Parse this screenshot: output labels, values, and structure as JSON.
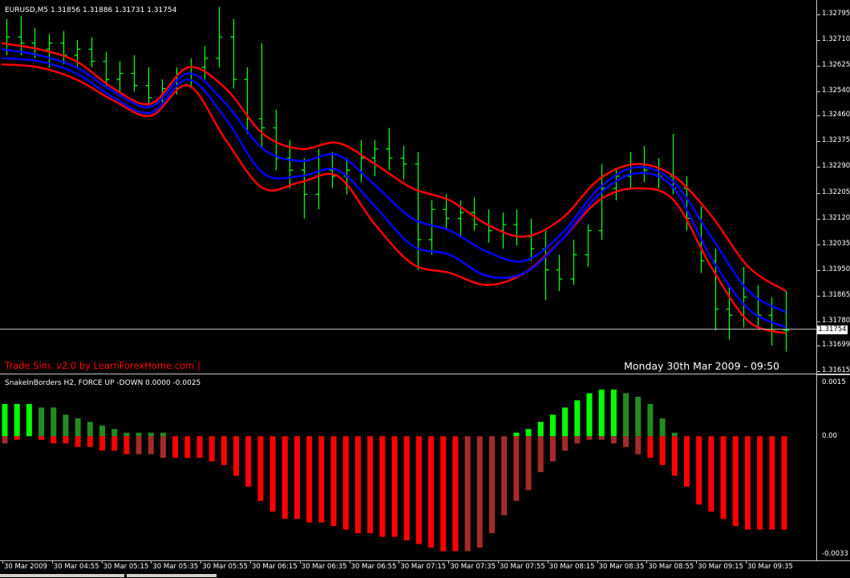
{
  "chart": {
    "symbol_info": "EURUSD,M5  1.31856 1.31886 1.31731 1.31754",
    "trade_sim": "Trade Sim. v2.0 by LearnForexHome.com |",
    "datetime": "Monday 30th Mar 2009 - 09:50",
    "current_price": "1.31754",
    "price_scale": [
      "1.32795",
      "1.32710",
      "1.32625",
      "1.32540",
      "1.32460",
      "1.32375",
      "1.32290",
      "1.32205",
      "1.32120",
      "1.32035",
      "1.31950",
      "1.31865",
      "1.31780",
      "1.31699",
      "1.31615"
    ],
    "indicator_title": "SnakeInBorders H2, FORCE UP -DOWN  0.0000 -0.0025",
    "indicator_scale": [
      "0.0015",
      "0.00",
      "-0.0033"
    ],
    "time_labels": [
      "30 Mar 2009",
      "30 Mar 04:55",
      "30 Mar 05:15",
      "30 Mar 05:35",
      "30 Mar 05:55",
      "30 Mar 06:15",
      "30 Mar 06:35",
      "30 Mar 06:55",
      "30 Mar 07:15",
      "30 Mar 07:35",
      "30 Mar 07:55",
      "30 Mar 08:15",
      "30 Mar 08:35",
      "30 Mar 08:55",
      "30 Mar 09:15",
      "30 Mar 09:35"
    ],
    "colors": {
      "bars": "#00ff00",
      "upper_band": "#ff0000",
      "middle_band": "#0000ff",
      "hist_up_strong": "#00ff00",
      "hist_up_weak": "#228b22",
      "hist_down_strong": "#ff0000",
      "hist_down_weak": "#a52a2a",
      "background": "#000000"
    }
  },
  "chart_data": [
    {
      "type": "ohlc",
      "symbol": "EURUSD",
      "timeframe": "M5",
      "ylim": [
        1.31615,
        1.32795
      ],
      "bars": [
        {
          "o": 1.327,
          "h": 1.3278,
          "l": 1.3266,
          "c": 1.3272
        },
        {
          "o": 1.3272,
          "h": 1.3279,
          "l": 1.3266,
          "c": 1.327
        },
        {
          "o": 1.327,
          "h": 1.3275,
          "l": 1.3265,
          "c": 1.3268
        },
        {
          "o": 1.3268,
          "h": 1.3273,
          "l": 1.3262,
          "c": 1.327
        },
        {
          "o": 1.327,
          "h": 1.3274,
          "l": 1.3263,
          "c": 1.3266
        },
        {
          "o": 1.3266,
          "h": 1.3271,
          "l": 1.3262,
          "c": 1.3268
        },
        {
          "o": 1.3268,
          "h": 1.3272,
          "l": 1.3262,
          "c": 1.3264
        },
        {
          "o": 1.3264,
          "h": 1.3267,
          "l": 1.3255,
          "c": 1.3258
        },
        {
          "o": 1.3258,
          "h": 1.3264,
          "l": 1.3254,
          "c": 1.326
        },
        {
          "o": 1.326,
          "h": 1.3266,
          "l": 1.3254,
          "c": 1.3256
        },
        {
          "o": 1.3256,
          "h": 1.3262,
          "l": 1.325,
          "c": 1.3252
        },
        {
          "o": 1.3252,
          "h": 1.3258,
          "l": 1.325,
          "c": 1.3255
        },
        {
          "o": 1.3255,
          "h": 1.3262,
          "l": 1.3253,
          "c": 1.326
        },
        {
          "o": 1.326,
          "h": 1.3265,
          "l": 1.3255,
          "c": 1.3262
        },
        {
          "o": 1.3262,
          "h": 1.3269,
          "l": 1.3258,
          "c": 1.3265
        },
        {
          "o": 1.3265,
          "h": 1.3282,
          "l": 1.3262,
          "c": 1.3272
        },
        {
          "o": 1.3272,
          "h": 1.3278,
          "l": 1.3255,
          "c": 1.3258
        },
        {
          "o": 1.3258,
          "h": 1.3262,
          "l": 1.324,
          "c": 1.3245
        },
        {
          "o": 1.3245,
          "h": 1.327,
          "l": 1.3235,
          "c": 1.3242
        },
        {
          "o": 1.3242,
          "h": 1.3248,
          "l": 1.3228,
          "c": 1.3232
        },
        {
          "o": 1.3232,
          "h": 1.3238,
          "l": 1.3222,
          "c": 1.3228
        },
        {
          "o": 1.3228,
          "h": 1.3232,
          "l": 1.3212,
          "c": 1.322
        },
        {
          "o": 1.322,
          "h": 1.3235,
          "l": 1.3215,
          "c": 1.3228
        },
        {
          "o": 1.3228,
          "h": 1.3234,
          "l": 1.3222,
          "c": 1.3226
        },
        {
          "o": 1.3226,
          "h": 1.3232,
          "l": 1.322,
          "c": 1.3228
        },
        {
          "o": 1.3228,
          "h": 1.3238,
          "l": 1.3224,
          "c": 1.3232
        },
        {
          "o": 1.3232,
          "h": 1.3238,
          "l": 1.3226,
          "c": 1.3235
        },
        {
          "o": 1.3235,
          "h": 1.3242,
          "l": 1.3228,
          "c": 1.3232
        },
        {
          "o": 1.3232,
          "h": 1.3236,
          "l": 1.3225,
          "c": 1.323
        },
        {
          "o": 1.323,
          "h": 1.3234,
          "l": 1.3195,
          "c": 1.3205
        },
        {
          "o": 1.3205,
          "h": 1.3218,
          "l": 1.32,
          "c": 1.3215
        },
        {
          "o": 1.3215,
          "h": 1.322,
          "l": 1.3208,
          "c": 1.3212
        },
        {
          "o": 1.3212,
          "h": 1.3218,
          "l": 1.3206,
          "c": 1.3214
        },
        {
          "o": 1.3214,
          "h": 1.3219,
          "l": 1.3208,
          "c": 1.321
        },
        {
          "o": 1.321,
          "h": 1.3215,
          "l": 1.3204,
          "c": 1.3208
        },
        {
          "o": 1.3208,
          "h": 1.3214,
          "l": 1.3202,
          "c": 1.321
        },
        {
          "o": 1.321,
          "h": 1.3215,
          "l": 1.3203,
          "c": 1.3206
        },
        {
          "o": 1.3206,
          "h": 1.3212,
          "l": 1.3198,
          "c": 1.3202
        },
        {
          "o": 1.3202,
          "h": 1.3208,
          "l": 1.3185,
          "c": 1.3195
        },
        {
          "o": 1.3195,
          "h": 1.32,
          "l": 1.3188,
          "c": 1.3192
        },
        {
          "o": 1.3192,
          "h": 1.3205,
          "l": 1.319,
          "c": 1.32
        },
        {
          "o": 1.32,
          "h": 1.321,
          "l": 1.3196,
          "c": 1.3208
        },
        {
          "o": 1.3208,
          "h": 1.323,
          "l": 1.3205,
          "c": 1.3222
        },
        {
          "o": 1.3222,
          "h": 1.3228,
          "l": 1.3218,
          "c": 1.3226
        },
        {
          "o": 1.3226,
          "h": 1.3234,
          "l": 1.3222,
          "c": 1.323
        },
        {
          "o": 1.323,
          "h": 1.3236,
          "l": 1.3224,
          "c": 1.3228
        },
        {
          "o": 1.3228,
          "h": 1.3232,
          "l": 1.3222,
          "c": 1.3226
        },
        {
          "o": 1.3226,
          "h": 1.324,
          "l": 1.322,
          "c": 1.3222
        },
        {
          "o": 1.3222,
          "h": 1.3226,
          "l": 1.3208,
          "c": 1.3212
        },
        {
          "o": 1.3212,
          "h": 1.3216,
          "l": 1.3194,
          "c": 1.3198
        },
        {
          "o": 1.3198,
          "h": 1.3202,
          "l": 1.3175,
          "c": 1.3182
        },
        {
          "o": 1.3182,
          "h": 1.319,
          "l": 1.3172,
          "c": 1.318
        },
        {
          "o": 1.318,
          "h": 1.3196,
          "l": 1.3176,
          "c": 1.3186
        },
        {
          "o": 1.3186,
          "h": 1.319,
          "l": 1.3176,
          "c": 1.318
        },
        {
          "o": 1.318,
          "h": 1.3186,
          "l": 1.317,
          "c": 1.3175
        },
        {
          "o": 1.3175,
          "h": 1.3188,
          "l": 1.3168,
          "c": 1.3175
        }
      ],
      "bands": {
        "upper": [
          1.327,
          1.3268,
          1.3264,
          1.3255,
          1.325,
          1.3262,
          1.3255,
          1.324,
          1.3235,
          1.3237,
          1.323,
          1.3222,
          1.3218,
          1.321,
          1.3206,
          1.3212,
          1.3225,
          1.323,
          1.3226,
          1.3213,
          1.3196,
          1.3188
        ],
        "middle_upper": [
          1.3268,
          1.3266,
          1.3262,
          1.3254,
          1.3249,
          1.326,
          1.325,
          1.3235,
          1.3231,
          1.3233,
          1.3223,
          1.3212,
          1.3208,
          1.3201,
          1.3198,
          1.3207,
          1.3222,
          1.3229,
          1.3224,
          1.3206,
          1.3188,
          1.3181
        ],
        "middle_lower": [
          1.3265,
          1.3264,
          1.326,
          1.3252,
          1.3247,
          1.3258,
          1.3245,
          1.3227,
          1.3226,
          1.3228,
          1.3216,
          1.3203,
          1.32,
          1.3193,
          1.3194,
          1.3205,
          1.322,
          1.3227,
          1.3222,
          1.3199,
          1.3182,
          1.3176
        ],
        "lower": [
          1.3263,
          1.3262,
          1.3258,
          1.3251,
          1.3246,
          1.3256,
          1.3238,
          1.3222,
          1.3224,
          1.3226,
          1.321,
          1.3197,
          1.3194,
          1.319,
          1.3194,
          1.3205,
          1.3218,
          1.3222,
          1.3218,
          1.3196,
          1.3178,
          1.3174
        ]
      }
    },
    {
      "type": "bar",
      "title": "SnakeInBorders H2, FORCE UP -DOWN  0.0000 -0.0025",
      "ylim": [
        -0.0033,
        0.0015
      ],
      "up": [
        0.0009,
        0.0009,
        0.0009,
        0.0008,
        0.0008,
        0.0006,
        0.0005,
        0.0004,
        0.0003,
        0.0002,
        0.0001,
        0.0001,
        0.0001,
        0.0001,
        0.0,
        0.0,
        0.0,
        0.0,
        0.0,
        0.0,
        0.0,
        0.0,
        0.0,
        0.0,
        0.0,
        0.0,
        0.0,
        0.0,
        0.0,
        0.0,
        0.0,
        0.0,
        0.0,
        0.0,
        0.0,
        0.0,
        0.0,
        0.0,
        0.0,
        0.0,
        0.0,
        0.0,
        0.0001,
        0.0002,
        0.0004,
        0.0006,
        0.0008,
        0.001,
        0.0012,
        0.0013,
        0.0013,
        0.0012,
        0.0011,
        0.0009,
        0.0005,
        0.0001,
        0.0,
        0.0,
        0.0,
        0.0,
        0.0,
        0.0,
        0.0,
        0.0,
        0.0
      ],
      "down": [
        -0.0002,
        -0.0001,
        0.0,
        -0.0001,
        -0.0002,
        -0.0002,
        -0.0003,
        -0.0003,
        -0.0004,
        -0.0004,
        -0.0005,
        -0.0005,
        -0.0005,
        -0.0006,
        -0.0006,
        -0.0006,
        -0.0006,
        -0.0007,
        -0.0008,
        -0.0011,
        -0.0014,
        -0.0018,
        -0.0021,
        -0.0023,
        -0.0023,
        -0.0024,
        -0.0024,
        -0.0025,
        -0.0026,
        -0.0027,
        -0.0027,
        -0.0028,
        -0.0028,
        -0.0029,
        -0.003,
        -0.0031,
        -0.0032,
        -0.0032,
        -0.0032,
        -0.0031,
        -0.0027,
        -0.0022,
        -0.0018,
        -0.0015,
        -0.001,
        -0.0007,
        -0.0004,
        -0.0002,
        -0.0001,
        -0.0001,
        -0.0002,
        -0.0003,
        -0.0005,
        -0.0006,
        -0.0008,
        -0.0011,
        -0.0014,
        -0.0019,
        -0.0021,
        -0.0023,
        -0.0025,
        -0.0026,
        -0.0026,
        -0.0026,
        -0.0026
      ],
      "up_strong": [
        true,
        true,
        true,
        false,
        false,
        false,
        false,
        false,
        false,
        false,
        false,
        false,
        false,
        false,
        false,
        false,
        false,
        false,
        false,
        false,
        false,
        false,
        false,
        false,
        false,
        false,
        false,
        false,
        false,
        false,
        false,
        false,
        false,
        false,
        false,
        false,
        false,
        false,
        false,
        false,
        false,
        false,
        true,
        true,
        true,
        true,
        true,
        true,
        true,
        true,
        true,
        false,
        false,
        false,
        false,
        false,
        false,
        false,
        false,
        false,
        false,
        false,
        false,
        false,
        false
      ],
      "down_strong": [
        false,
        true,
        true,
        true,
        true,
        true,
        true,
        true,
        true,
        true,
        true,
        false,
        false,
        false,
        true,
        true,
        true,
        true,
        true,
        true,
        true,
        true,
        true,
        true,
        true,
        true,
        true,
        true,
        true,
        true,
        true,
        true,
        true,
        true,
        true,
        true,
        true,
        true,
        false,
        false,
        false,
        false,
        false,
        false,
        false,
        false,
        false,
        false,
        false,
        false,
        false,
        false,
        false,
        true,
        true,
        true,
        true,
        true,
        true,
        true,
        true,
        true,
        true,
        true,
        true
      ]
    }
  ]
}
